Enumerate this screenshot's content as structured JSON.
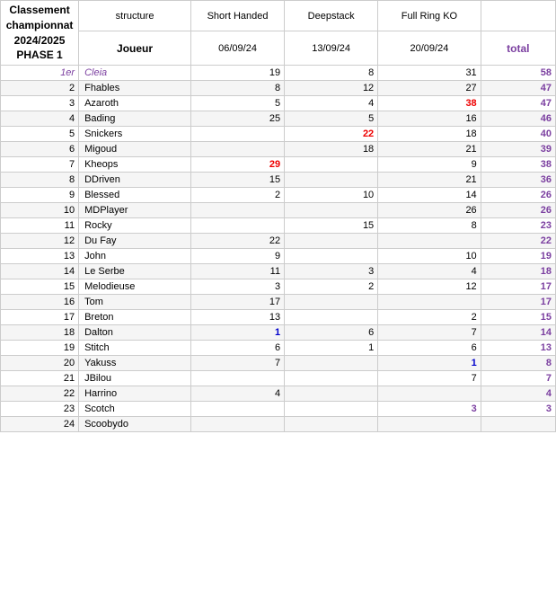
{
  "header": {
    "title_line1": "Classement",
    "title_line2": "championnat",
    "title_line3": "2024/2025",
    "title_line4": "PHASE 1",
    "col_structure": "structure",
    "col_sh": "Short Handed",
    "col_ds": "Deepstack",
    "col_frko": "Full Ring KO",
    "label_joueur": "Joueur",
    "date_sh": "06/09/24",
    "date_ds": "13/09/24",
    "date_frko": "20/09/24",
    "label_total": "total"
  },
  "rows": [
    {
      "rank": "1er",
      "name": "Cleia",
      "sh": "19",
      "ds": "8",
      "frko": "31",
      "total": "58",
      "rank_style": "first",
      "name_style": "first",
      "sh_style": "",
      "ds_style": "",
      "frko_style": "",
      "total_style": "purple"
    },
    {
      "rank": "2",
      "name": "Fhables",
      "sh": "8",
      "ds": "12",
      "frko": "27",
      "total": "47",
      "rank_style": "",
      "name_style": "",
      "sh_style": "",
      "ds_style": "",
      "frko_style": "",
      "total_style": "purple"
    },
    {
      "rank": "3",
      "name": "Azaroth",
      "sh": "5",
      "ds": "4",
      "frko": "38",
      "total": "47",
      "rank_style": "",
      "name_style": "",
      "sh_style": "",
      "ds_style": "",
      "frko_style": "red",
      "total_style": "purple"
    },
    {
      "rank": "4",
      "name": "Bading",
      "sh": "25",
      "ds": "5",
      "frko": "16",
      "total": "46",
      "rank_style": "",
      "name_style": "",
      "sh_style": "",
      "ds_style": "",
      "frko_style": "",
      "total_style": "purple"
    },
    {
      "rank": "5",
      "name": "Snickers",
      "sh": "",
      "ds": "22",
      "frko": "18",
      "total": "40",
      "rank_style": "",
      "name_style": "",
      "sh_style": "",
      "ds_style": "red",
      "frko_style": "",
      "total_style": "purple"
    },
    {
      "rank": "6",
      "name": "Migoud",
      "sh": "",
      "ds": "18",
      "frko": "21",
      "total": "39",
      "rank_style": "",
      "name_style": "",
      "sh_style": "",
      "ds_style": "",
      "frko_style": "",
      "total_style": "purple"
    },
    {
      "rank": "7",
      "name": "Kheops",
      "sh": "29",
      "ds": "",
      "frko": "9",
      "total": "38",
      "rank_style": "",
      "name_style": "",
      "sh_style": "red",
      "ds_style": "",
      "frko_style": "",
      "total_style": "purple"
    },
    {
      "rank": "8",
      "name": "DDriven",
      "sh": "15",
      "ds": "",
      "frko": "21",
      "total": "36",
      "rank_style": "",
      "name_style": "",
      "sh_style": "",
      "ds_style": "",
      "frko_style": "",
      "total_style": "purple"
    },
    {
      "rank": "9",
      "name": "Blessed",
      "sh": "2",
      "ds": "10",
      "frko": "14",
      "total": "26",
      "rank_style": "",
      "name_style": "",
      "sh_style": "",
      "ds_style": "",
      "frko_style": "",
      "total_style": "purple"
    },
    {
      "rank": "10",
      "name": "MDPlayer",
      "sh": "",
      "ds": "",
      "frko": "26",
      "total": "26",
      "rank_style": "",
      "name_style": "",
      "sh_style": "",
      "ds_style": "",
      "frko_style": "",
      "total_style": "purple"
    },
    {
      "rank": "11",
      "name": "Rocky",
      "sh": "",
      "ds": "15",
      "frko": "8",
      "total": "23",
      "rank_style": "",
      "name_style": "",
      "sh_style": "",
      "ds_style": "",
      "frko_style": "",
      "total_style": "purple"
    },
    {
      "rank": "12",
      "name": "Du Fay",
      "sh": "22",
      "ds": "",
      "frko": "",
      "total": "22",
      "rank_style": "",
      "name_style": "",
      "sh_style": "",
      "ds_style": "",
      "frko_style": "",
      "total_style": "purple"
    },
    {
      "rank": "13",
      "name": "John",
      "sh": "9",
      "ds": "",
      "frko": "10",
      "total": "19",
      "rank_style": "",
      "name_style": "",
      "sh_style": "",
      "ds_style": "",
      "frko_style": "",
      "total_style": "purple"
    },
    {
      "rank": "14",
      "name": "Le Serbe",
      "sh": "11",
      "ds": "3",
      "frko": "4",
      "total": "18",
      "rank_style": "",
      "name_style": "",
      "sh_style": "",
      "ds_style": "",
      "frko_style": "",
      "total_style": "purple"
    },
    {
      "rank": "15",
      "name": "Melodieuse",
      "sh": "3",
      "ds": "2",
      "frko": "12",
      "total": "17",
      "rank_style": "",
      "name_style": "",
      "sh_style": "",
      "ds_style": "",
      "frko_style": "",
      "total_style": "purple"
    },
    {
      "rank": "16",
      "name": "Tom",
      "sh": "17",
      "ds": "",
      "frko": "",
      "total": "17",
      "rank_style": "",
      "name_style": "",
      "sh_style": "",
      "ds_style": "",
      "frko_style": "",
      "total_style": "purple"
    },
    {
      "rank": "17",
      "name": "Breton",
      "sh": "13",
      "ds": "",
      "frko": "2",
      "total": "15",
      "rank_style": "",
      "name_style": "",
      "sh_style": "",
      "ds_style": "",
      "frko_style": "",
      "total_style": "purple"
    },
    {
      "rank": "18",
      "name": "Dalton",
      "sh": "1",
      "ds": "6",
      "frko": "7",
      "total": "14",
      "rank_style": "",
      "name_style": "",
      "sh_style": "blue",
      "ds_style": "",
      "frko_style": "",
      "total_style": "purple"
    },
    {
      "rank": "19",
      "name": "Stitch",
      "sh": "6",
      "ds": "1",
      "frko": "6",
      "total": "13",
      "rank_style": "",
      "name_style": "",
      "sh_style": "",
      "ds_style": "",
      "frko_style": "",
      "total_style": "purple"
    },
    {
      "rank": "20",
      "name": "Yakuss",
      "sh": "7",
      "ds": "",
      "frko": "1",
      "total": "8",
      "rank_style": "",
      "name_style": "",
      "sh_style": "",
      "ds_style": "",
      "frko_style": "blue",
      "total_style": "purple"
    },
    {
      "rank": "21",
      "name": "JBilou",
      "sh": "",
      "ds": "",
      "frko": "7",
      "total": "7",
      "rank_style": "",
      "name_style": "",
      "sh_style": "",
      "ds_style": "",
      "frko_style": "",
      "total_style": "purple"
    },
    {
      "rank": "22",
      "name": "Harrino",
      "sh": "4",
      "ds": "",
      "frko": "",
      "total": "4",
      "rank_style": "",
      "name_style": "",
      "sh_style": "",
      "ds_style": "",
      "frko_style": "",
      "total_style": "purple"
    },
    {
      "rank": "23",
      "name": "Scotch",
      "sh": "",
      "ds": "",
      "frko": "3",
      "total": "3",
      "rank_style": "",
      "name_style": "",
      "sh_style": "",
      "ds_style": "",
      "frko_style": "purple",
      "total_style": "purple"
    },
    {
      "rank": "24",
      "name": "Scoobydo",
      "sh": "",
      "ds": "",
      "frko": "",
      "total": "",
      "rank_style": "",
      "name_style": "",
      "sh_style": "",
      "ds_style": "",
      "frko_style": "",
      "total_style": "purple"
    }
  ]
}
